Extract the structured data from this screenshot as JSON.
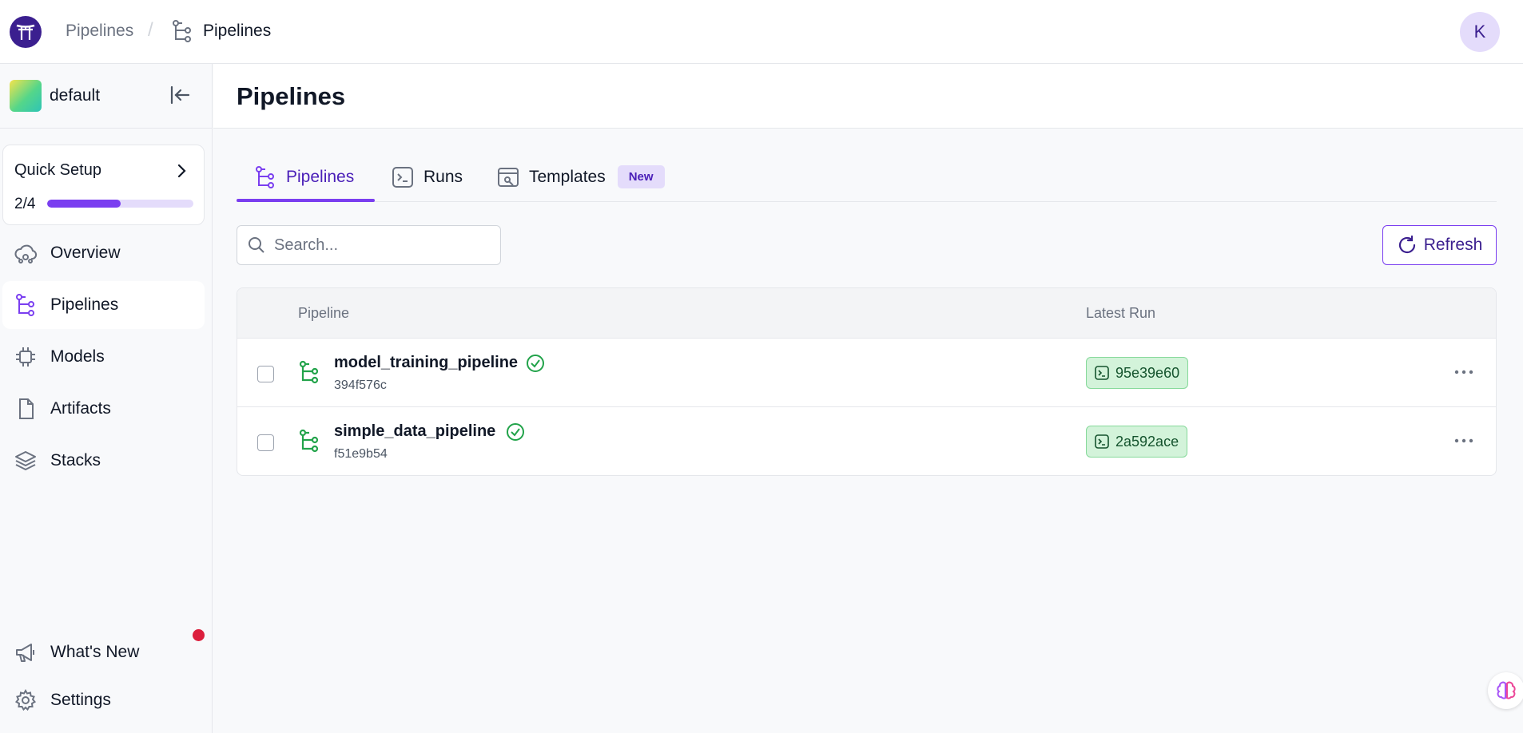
{
  "header": {
    "breadcrumb": [
      "Pipelines",
      "Pipelines"
    ],
    "separator": "/",
    "avatar_initial": "K"
  },
  "sidebar": {
    "workspace": "default",
    "quick_setup": {
      "title": "Quick Setup",
      "progress_text": "2/4",
      "progress_fraction": 0.5
    },
    "items": [
      {
        "label": "Overview",
        "icon": "cloud-icon"
      },
      {
        "label": "Pipelines",
        "icon": "pipeline-icon",
        "active": true
      },
      {
        "label": "Models",
        "icon": "chip-icon"
      },
      {
        "label": "Artifacts",
        "icon": "file-icon"
      },
      {
        "label": "Stacks",
        "icon": "stack-layers-icon"
      }
    ],
    "bottom_items": [
      {
        "label": "What's New",
        "icon": "megaphone-icon",
        "has_notification": true
      },
      {
        "label": "Settings",
        "icon": "gear-icon"
      }
    ]
  },
  "main": {
    "title": "Pipelines",
    "tabs": [
      {
        "label": "Pipelines",
        "active": true
      },
      {
        "label": "Runs"
      },
      {
        "label": "Templates",
        "badge": "New"
      }
    ],
    "search": {
      "placeholder": "Search...",
      "value": ""
    },
    "refresh_label": "Refresh",
    "table": {
      "columns": [
        "Pipeline",
        "Latest Run"
      ],
      "rows": [
        {
          "name": "model_training_pipeline",
          "id": "394f576c",
          "status": "completed",
          "latest_run": "95e39e60"
        },
        {
          "name": "simple_data_pipeline",
          "id": "f51e9b54",
          "status": "completed",
          "latest_run": "2a592ace"
        }
      ]
    }
  },
  "colors": {
    "accent": "#7a3ef0",
    "accent_dark": "#4a1fb8",
    "success": "#22a34a",
    "success_bg": "#d3f3da",
    "notification": "#dc1f3d"
  }
}
